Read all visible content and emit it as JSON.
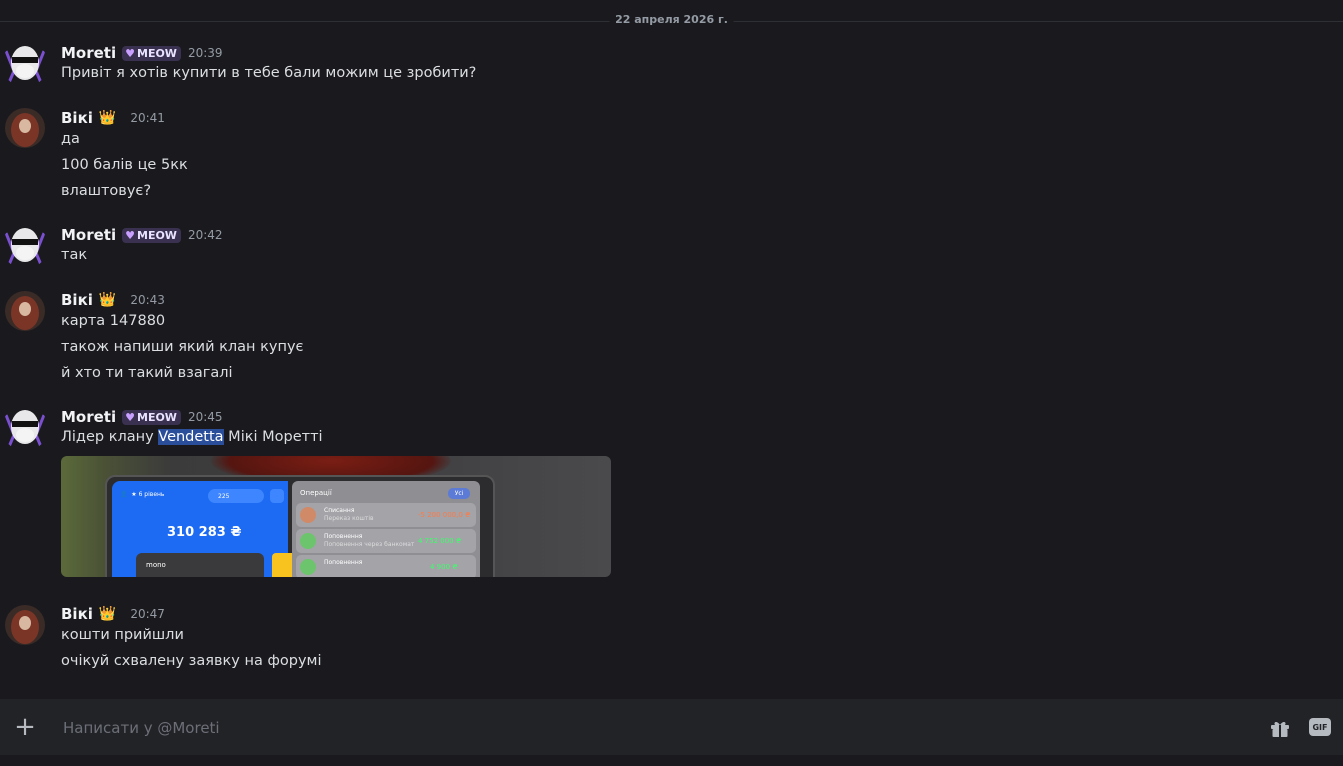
{
  "date_divider": "22 апреля 2026 г.",
  "messages": [
    {
      "author": "Moreti",
      "tag": "MEOW",
      "time": "20:39",
      "lines": [
        "Привіт я хотів купити в тебе бали можим це зробити?"
      ]
    },
    {
      "author": "Вікі",
      "badge": "👑",
      "time": "20:41",
      "lines": [
        "да",
        "100 балів це 5кк",
        "влаштовує?"
      ]
    },
    {
      "author": "Moreti",
      "tag": "MEOW",
      "time": "20:42",
      "lines": [
        "так"
      ]
    },
    {
      "author": "Вікі",
      "badge": "👑",
      "time": "20:43",
      "lines": [
        "карта 147880",
        "також напиши який клан купує",
        "й хто ти такий взагалі"
      ]
    },
    {
      "author": "Moreti",
      "tag": "MEOW",
      "time": "20:45",
      "line_parts": {
        "before": "Лідер клану ",
        "highlight": "Vendetta",
        "after": " Мікі Моретті"
      }
    },
    {
      "author": "Вікі",
      "badge": "👑",
      "time": "20:47",
      "lines": [
        "кошти прийшли",
        "очікуй схвалену заявку на форумі"
      ]
    }
  ],
  "attachment": {
    "level": "6 рівень",
    "pill_value": "225",
    "balance": "310 283 ₴",
    "card_label": "mono",
    "ops_title": "Операції",
    "ops_filter": "Усі",
    "operations": [
      {
        "name": "Списання",
        "sub": "Переказ коштів",
        "amount": "-5 200 000,0 ₴",
        "color": "#ff7a45",
        "dot": "#d08a68"
      },
      {
        "name": "Поповнення",
        "sub": "Поповнення через банкомат",
        "amount": "4 752 000 ₴",
        "color": "#3cff6b",
        "dot": "#6cc56c"
      },
      {
        "name": "Поповнення",
        "sub": "",
        "amount": "4 900 ₴",
        "color": "#3cff6b",
        "dot": "#6cc56c"
      }
    ]
  },
  "composer": {
    "placeholder": "Написати у @Moreti",
    "gif_label": "GIF"
  }
}
